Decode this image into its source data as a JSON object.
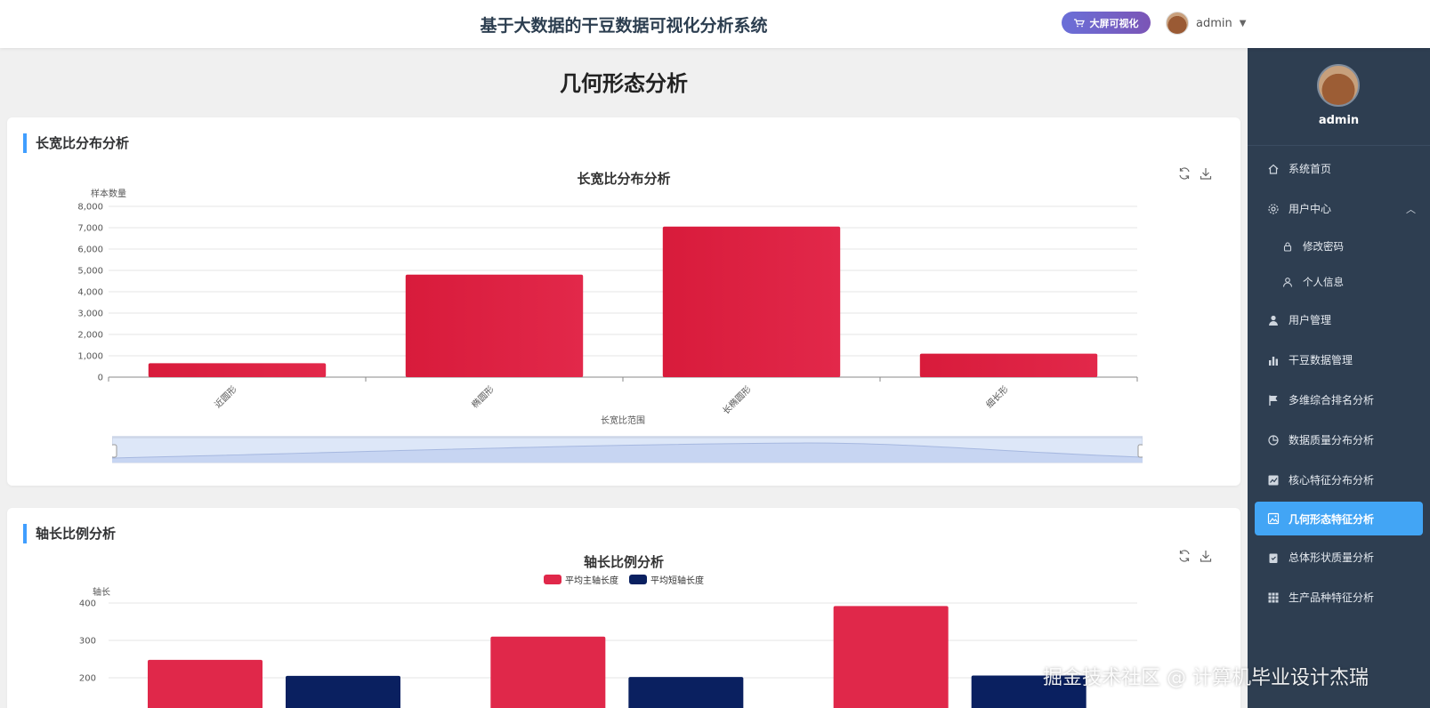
{
  "header": {
    "title": "基于大数据的干豆数据可视化分析系统",
    "bigscreen_label": "大屏可视化",
    "username": "admin"
  },
  "page": {
    "title": "几何形态分析"
  },
  "section1": {
    "heading": "长宽比分布分析",
    "chart_data": {
      "type": "bar",
      "title": "长宽比分布分析",
      "xlabel": "长宽比范围",
      "ylabel": "样本数量",
      "categories": [
        "近圆形",
        "椭圆形",
        "长椭圆形",
        "细长形"
      ],
      "values": [
        650,
        4800,
        7050,
        1100
      ],
      "ylim": [
        0,
        8000
      ],
      "yticks": [
        "0",
        "1,000",
        "2,000",
        "3,000",
        "4,000",
        "5,000",
        "6,000",
        "7,000",
        "8,000"
      ],
      "color": "#dc1e3c",
      "grid": true,
      "datazoom": true
    }
  },
  "section2": {
    "heading": "轴长比例分析",
    "chart_data": {
      "type": "bar",
      "title": "轴长比例分析",
      "ylabel": "轴长",
      "categories": [
        "",
        "",
        ""
      ],
      "series": [
        {
          "name": "平均主轴长度",
          "values": [
            248,
            310,
            392
          ],
          "color": "#e0284a"
        },
        {
          "name": "平均短轴长度",
          "values": [
            205,
            202,
            206
          ],
          "color": "#0a2060"
        }
      ],
      "yticks": [
        "200",
        "300",
        "400"
      ],
      "ylim": [
        0,
        400
      ],
      "legend": "top-center"
    }
  },
  "sidebar": {
    "username": "admin",
    "items": [
      {
        "label": "系统首页",
        "icon": "home-icon"
      },
      {
        "label": "用户中心",
        "icon": "gear-icon",
        "expanded": true
      },
      {
        "label": "修改密码",
        "icon": "lock-icon",
        "sub": true
      },
      {
        "label": "个人信息",
        "icon": "user-outline-icon",
        "sub": true
      },
      {
        "label": "用户管理",
        "icon": "user-icon"
      },
      {
        "label": "干豆数据管理",
        "icon": "bar-chart-icon"
      },
      {
        "label": "多维综合排名分析",
        "icon": "flag-icon"
      },
      {
        "label": "数据质量分布分析",
        "icon": "pie-icon"
      },
      {
        "label": "核心特征分布分析",
        "icon": "trend-icon"
      },
      {
        "label": "几何形态特征分析",
        "icon": "picture-icon",
        "active": true
      },
      {
        "label": "总体形状质量分析",
        "icon": "clipboard-icon"
      },
      {
        "label": "生产品种特征分析",
        "icon": "grid-icon"
      }
    ]
  },
  "watermark": "掘金技术社区 @ 计算机毕业设计杰瑞"
}
